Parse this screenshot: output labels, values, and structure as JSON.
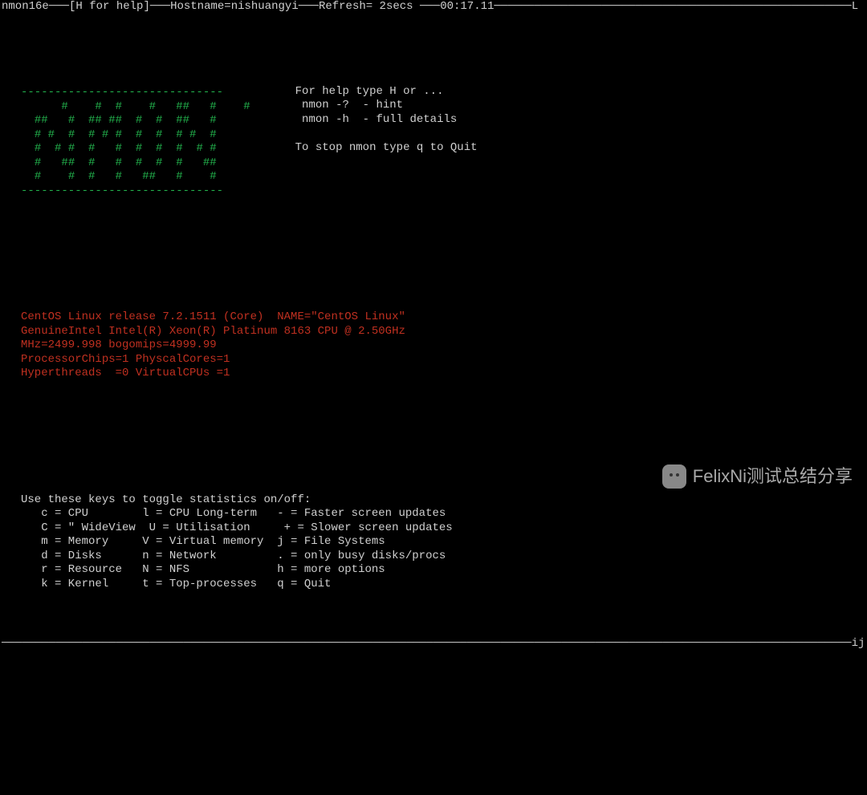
{
  "topbar": {
    "version": "nmon16e",
    "help_hint": "[H for help]",
    "hostname_label": "Hostname=",
    "hostname": "nishuangyi",
    "refresh_label": "Refresh=",
    "refresh": " 2secs",
    "clock": "00:17.11",
    "right_marker": "L"
  },
  "logo": {
    "dashes_top": "------------------------------",
    "l1": "    #    #  #    #   ##   #    #",
    "l2": "##   #  ## ##  #  #  ##   #",
    "l3": "# #  #  # # #  #  #  # #  #",
    "l4": "#  # #  #   #  #  #  #  # #",
    "l5": "#   ##  #   #  #  #  #   ##",
    "l6": "#    #  #   #   ##   #    #",
    "dashes_bot": "------------------------------"
  },
  "help": {
    "line1": "For help type H or ...",
    "line2": " nmon -?  - hint",
    "line3": " nmon -h  - full details",
    "blank": " ",
    "line4": "To stop nmon type q to Quit"
  },
  "sysinfo": {
    "os": "CentOS Linux release 7.2.1511 (Core)  NAME=\"CentOS Linux\"",
    "cpu": "GenuineIntel Intel(R) Xeon(R) Platinum 8163 CPU @ 2.50GHz",
    "mhz": "MHz=2499.998 bogomips=4999.99",
    "chips": "ProcessorChips=1 PhyscalCores=1",
    "ht": "Hyperthreads  =0 VirtualCPUs =1"
  },
  "keyshdr": "Use these keys to toggle statistics on/off:",
  "keys": {
    "r1": "   c = CPU        l = CPU Long-term   - = Faster screen updates",
    "r2": "   C = \" WideView  U = Utilisation     + = Slower screen updates",
    "r3": "   m = Memory     V = Virtual memory  j = File Systems",
    "r4": "   d = Disks      n = Network         . = only busy disks/procs",
    "r5": "   r = Resource   N = NFS             h = more options",
    "r6": "   k = Kernel     t = Top-processes   q = Quit"
  },
  "sep_right_marker": "ij",
  "watermark": "FelixNi测试总结分享"
}
